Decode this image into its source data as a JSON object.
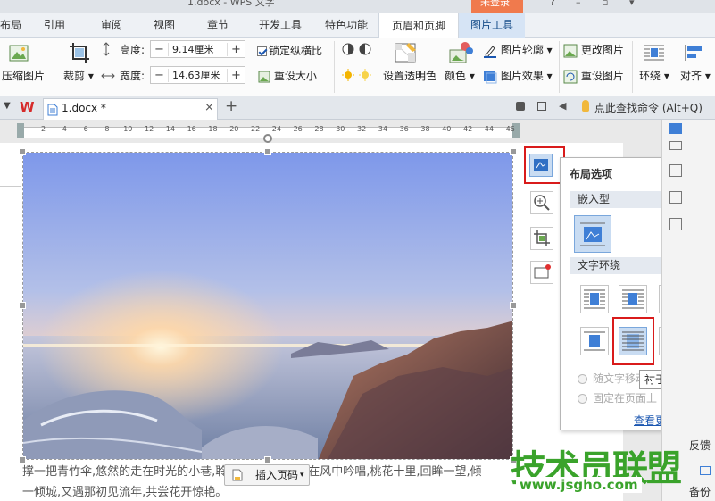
{
  "window": {
    "title": "1.docx - WPS 文字",
    "login_label": "未登录",
    "help_icon": "?",
    "minimize_icon": "–"
  },
  "menu": {
    "tabs": [
      "布局",
      "引用",
      "审阅",
      "视图",
      "章节",
      "开发工具",
      "特色功能",
      "页眉和页脚",
      "图片工具"
    ],
    "active": "页眉和页脚",
    "context": "图片工具"
  },
  "ribbon": {
    "compress_label": "压缩图片",
    "crop_label": "裁剪",
    "height_label": "高度:",
    "height_value": "9.14厘米",
    "width_label": "宽度:",
    "width_value": "14.63厘米",
    "lock_ratio_label": "锁定纵横比",
    "reset_size_label": "重设大小",
    "transparent_label": "设置透明色",
    "color_label": "颜色",
    "outline_label": "图片轮廓",
    "effect_label": "图片效果",
    "change_label": "更改图片",
    "reset_pic_label": "重设图片",
    "wrap_label": "环绕",
    "align_label": "对齐",
    "minus": "−",
    "plus": "+"
  },
  "tabbar": {
    "doc_name": "1.docx *",
    "close": "×",
    "new_tab": "+",
    "search_hint": "点此查找命令 (Alt+Q)"
  },
  "ruler": {
    "ticks": [
      "2",
      "4",
      "6",
      "8",
      "10",
      "12",
      "14",
      "16",
      "18",
      "20",
      "22",
      "24",
      "26",
      "28",
      "30",
      "32",
      "34",
      "36",
      "38",
      "40",
      "42",
      "44",
      "46"
    ]
  },
  "layout_panel": {
    "title": "布局选项",
    "close": "×",
    "inline_section": "嵌入型",
    "wrap_section": "文字环绕",
    "radio_move": "随文字移动",
    "radio_fixed": "固定在页面上",
    "more_link": "查看更多..."
  },
  "tooltip": "衬于文字下方",
  "body": {
    "line1": "撑一把青竹伞,悠然的走在时光的小巷,聆听杨柳依依暮集在风中吟唱,桃花十里,回眸一望,倾",
    "line2": "一倾城,又遇那初见流年,共尝花开惊艳。",
    "insert_page_button": "插入页码"
  },
  "sidebar": {
    "feedback": "反馈",
    "backup": "备份"
  },
  "watermark": {
    "brand": "技术员联盟",
    "url": "www.jsgho.com"
  },
  "colors": {
    "accent": "#1a56b0",
    "highlight_red": "#d91b1b",
    "brand_green": "#3aa32b"
  }
}
